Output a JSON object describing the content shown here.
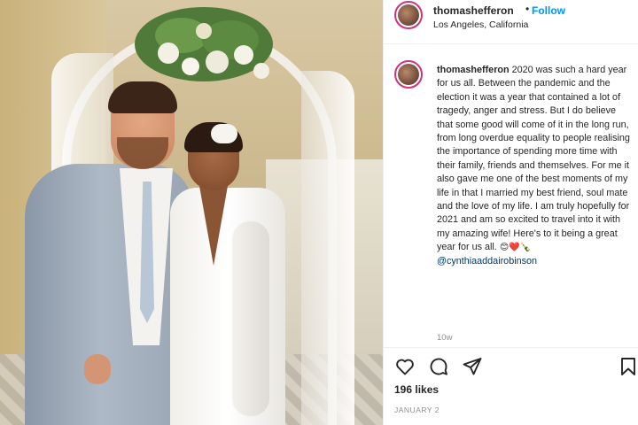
{
  "post": {
    "username": "thomashefferon",
    "follow_label": "Follow",
    "dot": "•",
    "location": "Los Angeles, California",
    "caption_username": "thomashefferon",
    "caption_text": " 2020 was such a hard year for us all. Between the pandemic and the election it was a year that contained a lot of tragedy, anger and stress. But I do believe that some good will come of it in the long run, from long overdue equality to people realising the importance of spending more time with their family, friends and themselves. For me it also gave me one of the best moments of my life in that I married my best friend, soul mate and the love of my life. I am truly hopefully for 2021 and am so excited to travel into it with my amazing wife! Here's to it being a great year for us all. ",
    "caption_emojis": "😊❤️🍾",
    "caption_mention": "@cynthiaaddairobinson",
    "time_ago": "10w",
    "likes": "196 likes",
    "date": "JANUARY 2"
  },
  "icons": {
    "like": "heart-icon",
    "comment": "comment-icon",
    "share": "paper-plane-icon",
    "save": "bookmark-icon"
  },
  "colors": {
    "follow_blue": "#0095f6",
    "mention_blue": "#00376b",
    "story_ring": "#d0337a",
    "muted_gray": "#8e8e8e"
  }
}
